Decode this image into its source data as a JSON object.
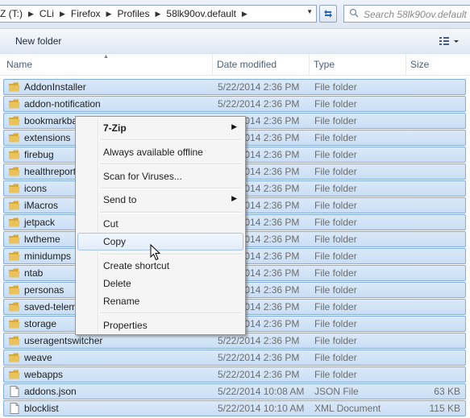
{
  "addressbar": {
    "crumbs": [
      "Z (T:)",
      "CLi",
      "Firefox",
      "Profiles",
      "58lk90ov.default"
    ],
    "search_placeholder": "Search 58lk90ov.default"
  },
  "toolbar": {
    "new_folder_label": "New folder"
  },
  "columns": {
    "name": "Name",
    "date": "Date modified",
    "type": "Type",
    "size": "Size"
  },
  "files": [
    {
      "name": "AddonInstaller",
      "date": "5/22/2014 2:36 PM",
      "type": "File folder",
      "size": "",
      "kind": "folder"
    },
    {
      "name": "addon-notification",
      "date": "5/22/2014 2:36 PM",
      "type": "File folder",
      "size": "",
      "kind": "folder"
    },
    {
      "name": "bookmarkba",
      "date": "5/22/2014 2:36 PM",
      "type": "File folder",
      "size": "",
      "kind": "folder"
    },
    {
      "name": "extensions",
      "date": "5/22/2014 2:36 PM",
      "type": "File folder",
      "size": "",
      "kind": "folder"
    },
    {
      "name": "firebug",
      "date": "5/22/2014 2:36 PM",
      "type": "File folder",
      "size": "",
      "kind": "folder"
    },
    {
      "name": "healthreport",
      "date": "5/22/2014 2:36 PM",
      "type": "File folder",
      "size": "",
      "kind": "folder"
    },
    {
      "name": "icons",
      "date": "5/22/2014 2:36 PM",
      "type": "File folder",
      "size": "",
      "kind": "folder"
    },
    {
      "name": "iMacros",
      "date": "5/22/2014 2:36 PM",
      "type": "File folder",
      "size": "",
      "kind": "folder"
    },
    {
      "name": "jetpack",
      "date": "5/22/2014 2:36 PM",
      "type": "File folder",
      "size": "",
      "kind": "folder"
    },
    {
      "name": "lwtheme",
      "date": "5/22/2014 2:36 PM",
      "type": "File folder",
      "size": "",
      "kind": "folder"
    },
    {
      "name": "minidumps",
      "date": "5/22/2014 2:36 PM",
      "type": "File folder",
      "size": "",
      "kind": "folder"
    },
    {
      "name": "ntab",
      "date": "5/22/2014 2:36 PM",
      "type": "File folder",
      "size": "",
      "kind": "folder"
    },
    {
      "name": "personas",
      "date": "5/22/2014 2:36 PM",
      "type": "File folder",
      "size": "",
      "kind": "folder"
    },
    {
      "name": "saved-telem",
      "date": "5/22/2014 2:36 PM",
      "type": "File folder",
      "size": "",
      "kind": "folder"
    },
    {
      "name": "storage",
      "date": "5/22/2014 2:36 PM",
      "type": "File folder",
      "size": "",
      "kind": "folder"
    },
    {
      "name": "useragentswitcher",
      "date": "5/22/2014 2:36 PM",
      "type": "File folder",
      "size": "",
      "kind": "folder"
    },
    {
      "name": "weave",
      "date": "5/22/2014 2:36 PM",
      "type": "File folder",
      "size": "",
      "kind": "folder"
    },
    {
      "name": "webapps",
      "date": "5/22/2014 2:36 PM",
      "type": "File folder",
      "size": "",
      "kind": "folder"
    },
    {
      "name": "addons.json",
      "date": "5/22/2014 10:08 AM",
      "type": "JSON File",
      "size": "63 KB",
      "kind": "file"
    },
    {
      "name": "blocklist",
      "date": "5/22/2014 10:10 AM",
      "type": "XML Document",
      "size": "115 KB",
      "kind": "file"
    }
  ],
  "context_menu": {
    "items": [
      {
        "label": "7-Zip",
        "submenu": true,
        "bold": true
      },
      {
        "label": "Always available offline"
      },
      {
        "label": "Scan for Viruses..."
      },
      {
        "label": "Send to",
        "submenu": true
      },
      {
        "label": "Cut"
      },
      {
        "label": "Copy",
        "highlighted": true
      },
      {
        "label": "Create shortcut"
      },
      {
        "label": "Delete"
      },
      {
        "label": "Rename"
      },
      {
        "label": "Properties"
      }
    ],
    "submenu_glyph": "▶"
  },
  "colors": {
    "selection_bg": "#cfe2f7",
    "selection_border": "#84acdd",
    "folder": "#e9c25a"
  },
  "icons": {
    "folder": "folder-icon",
    "file": "file-icon",
    "refresh": "refresh-icon",
    "search": "search-icon",
    "view": "view-options-icon"
  }
}
